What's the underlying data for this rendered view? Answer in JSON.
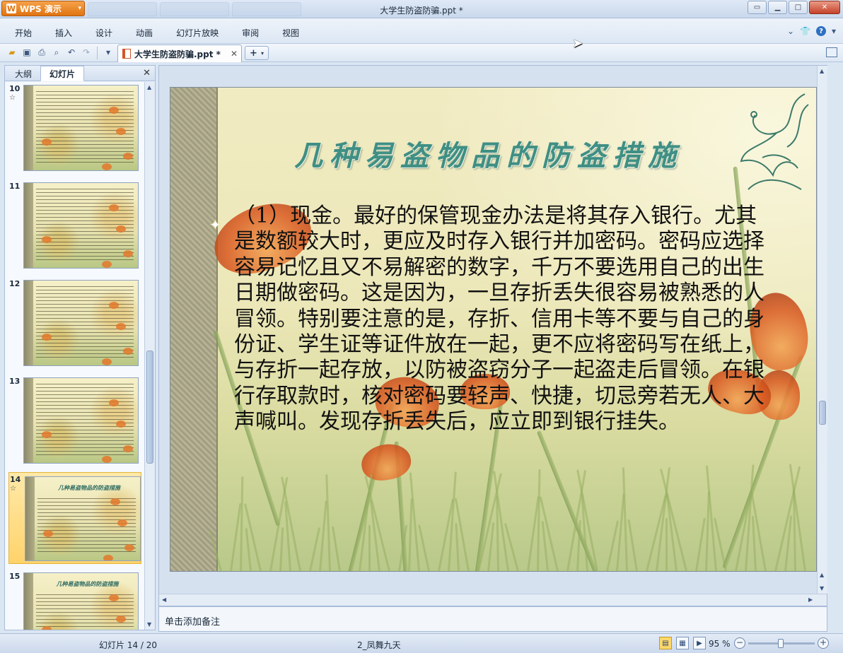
{
  "app": {
    "brand": "WPS 演示",
    "window_title": "大学生防盗防骗.ppt *"
  },
  "menu": [
    "开始",
    "插入",
    "设计",
    "动画",
    "幻灯片放映",
    "审阅",
    "视图"
  ],
  "toolbar": {
    "icons": [
      "open-icon",
      "save-icon",
      "print-icon",
      "print-preview-icon",
      "undo-icon",
      "redo-icon",
      "customize-icon"
    ],
    "doc_tab": "大学生防盗防骗.ppt *",
    "new_tab_label": "+"
  },
  "left_panel": {
    "tabs": [
      "大纲",
      "幻灯片"
    ],
    "active_tab": "幻灯片",
    "thumbnails": [
      {
        "number": "10",
        "starred": true,
        "selected": false,
        "title": ""
      },
      {
        "number": "11",
        "starred": false,
        "selected": false,
        "title": ""
      },
      {
        "number": "12",
        "starred": false,
        "selected": false,
        "title": ""
      },
      {
        "number": "13",
        "starred": false,
        "selected": false,
        "title": ""
      },
      {
        "number": "14",
        "starred": true,
        "selected": true,
        "title": "几种易盗物品的防盗措施"
      },
      {
        "number": "15",
        "starred": false,
        "selected": false,
        "title": "几种易盗物品的防盗措施"
      }
    ]
  },
  "slide": {
    "title": "几种易盗物品的防盗措施",
    "body": "（1）现金。最好的保管现金办法是将其存入银行。尤其是数额较大时，更应及时存入银行并加密码。密码应选择容易记忆且又不易解密的数字，千万不要选用自己的出生日期做密码。这是因为，一旦存折丢失很容易被熟悉的人冒领。特别要注意的是，存折、信用卡等不要与自己的身份证、学生证等证件放在一起，更不应将密码写在纸上，与存折一起存放，以防被盗窃分子一起盗走后冒领。在银行存取款时，核对密码要轻声、快捷，切忌旁若无人、大声喊叫。发现存折丢失后，应立即到银行挂失。"
  },
  "notes": {
    "placeholder": "单击添加备注"
  },
  "status": {
    "slide_indicator": "幻灯片 14 / 20",
    "theme": "2_凤舞九天",
    "zoom": "95 %",
    "zoom_level_percent": 95
  }
}
